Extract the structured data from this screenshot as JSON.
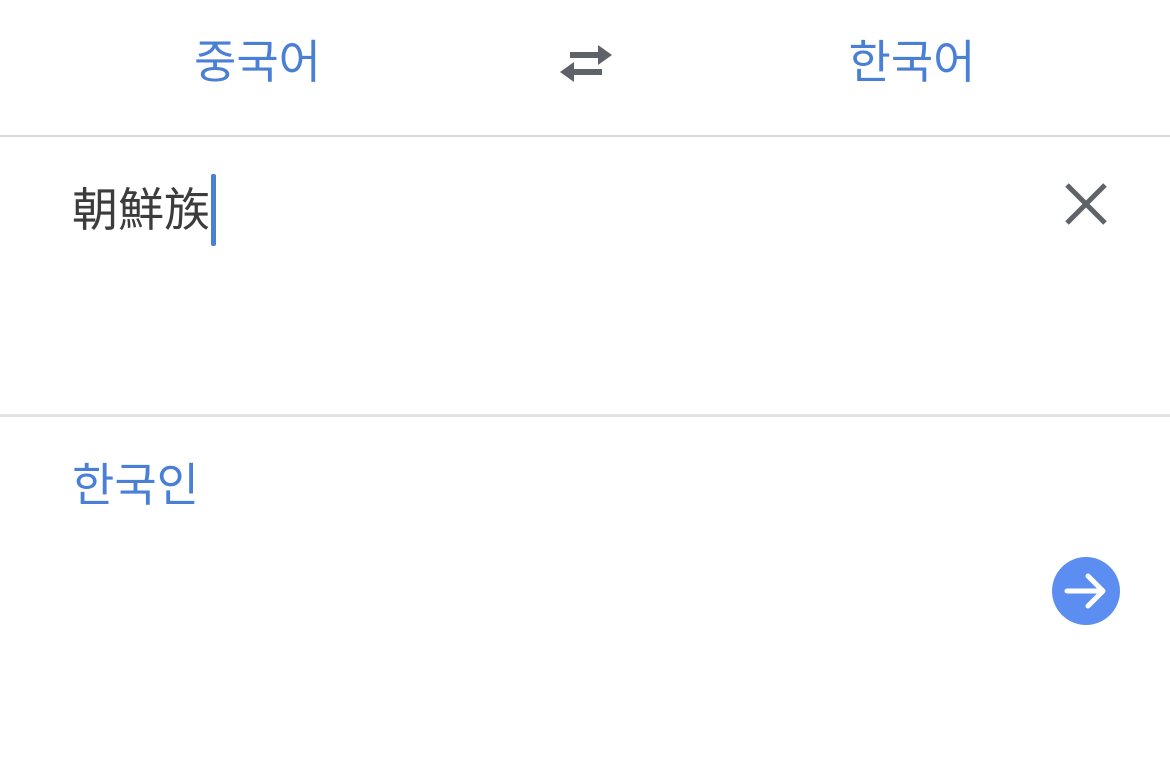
{
  "language_bar": {
    "source_language": "중국어",
    "target_language": "한국어",
    "swap_icon": "swap-arrows-icon"
  },
  "input": {
    "text": "朝鮮族",
    "clear_icon": "close-icon"
  },
  "result": {
    "text": "한국인",
    "go_icon": "arrow-right-icon"
  },
  "colors": {
    "accent": "#4a7fd6",
    "go_button": "#5b8ef0",
    "icon_gray": "#5f6368",
    "divider": "#d9d9d9"
  }
}
